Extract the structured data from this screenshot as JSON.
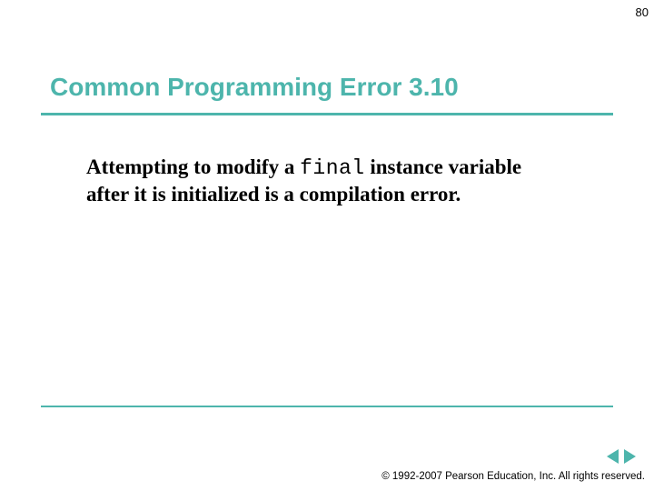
{
  "page_number": "80",
  "title": "Common Programming Error 3.10",
  "body": {
    "prefix": "Attempting to modify a ",
    "code": "final",
    "suffix": " instance variable after it is initialized is a compilation error."
  },
  "copyright": "© 1992-2007 Pearson Education, Inc.  All rights reserved."
}
